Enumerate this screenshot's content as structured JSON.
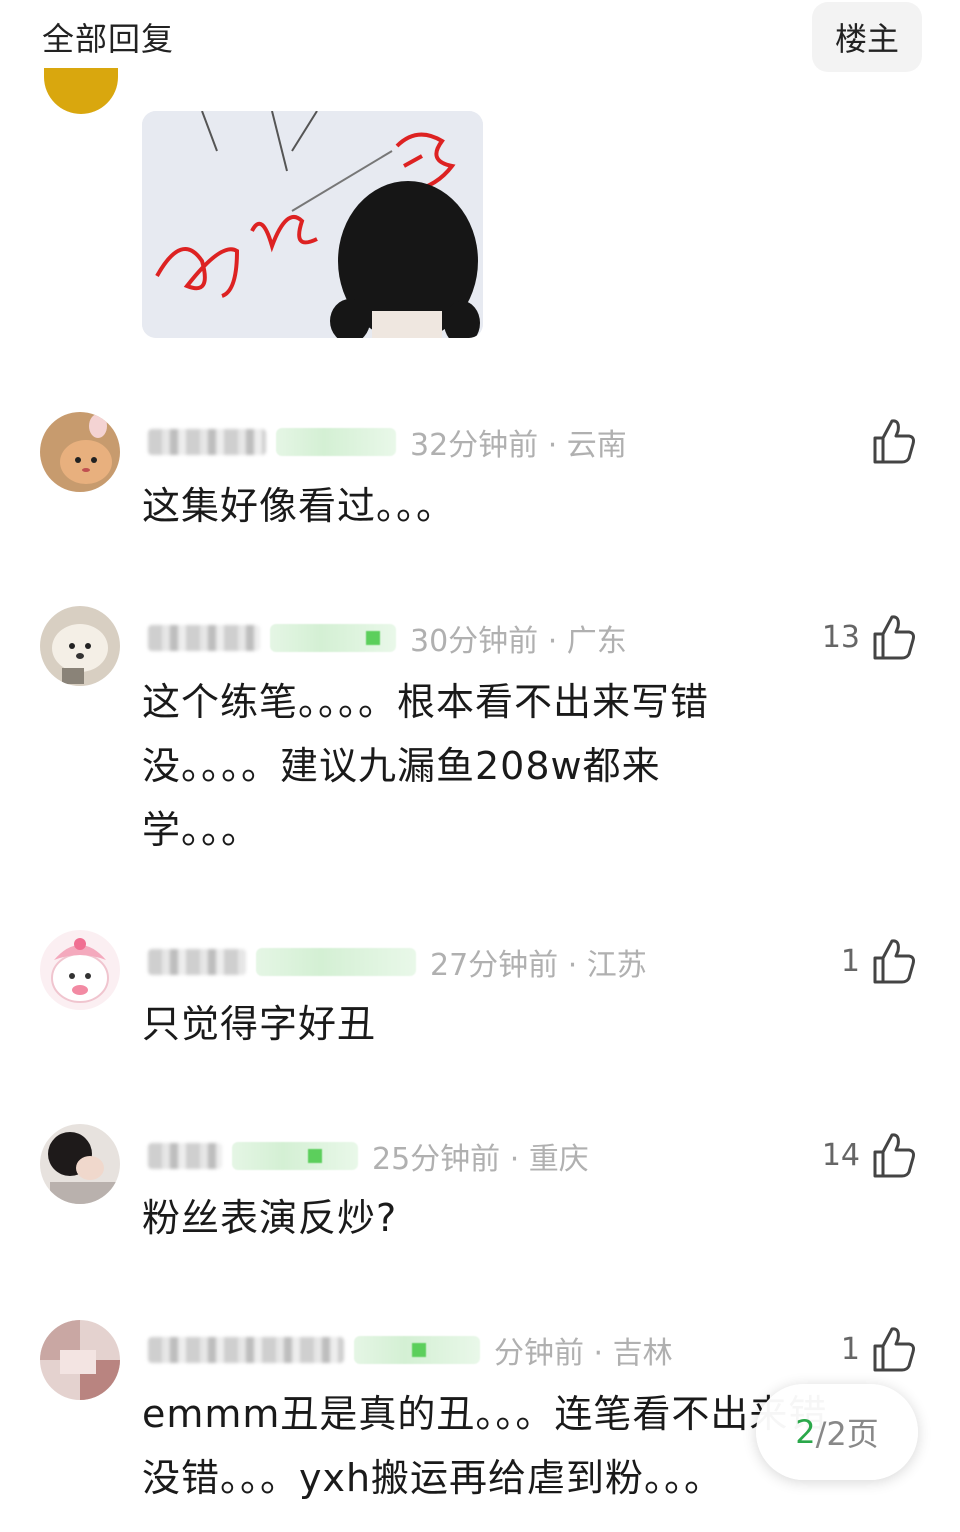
{
  "header": {
    "title": "全部回复",
    "filter_button": "楼主"
  },
  "comments": [
    {
      "meta": "32分钟前 · 云南",
      "likes": "",
      "text": [
        "这集好像看过。。。"
      ]
    },
    {
      "meta": "30分钟前 · 广东",
      "likes": "13",
      "text": [
        "这个练笔。。。。根本看不出来写错",
        "没。。。。建议九漏鱼208w都来",
        "学。。。"
      ]
    },
    {
      "meta": "27分钟前 · 江苏",
      "likes": "1",
      "text": [
        "只觉得字好丑"
      ]
    },
    {
      "meta": "25分钟前 · 重庆",
      "likes": "14",
      "text": [
        "粉丝表演反炒?"
      ]
    },
    {
      "meta": "分钟前 · 吉林",
      "likes": "1",
      "text": [
        "emmm丑是真的丑。。。连笔看不出来错",
        "没错。。。yxh搬运再给虐到粉。。。"
      ]
    }
  ],
  "pager": {
    "current": "2",
    "total": "/2页"
  },
  "colors": {
    "accent_green": "#2aa84a",
    "meta_gray": "#b3b3b3"
  },
  "icons": {
    "like": "thumbs-up-icon"
  }
}
